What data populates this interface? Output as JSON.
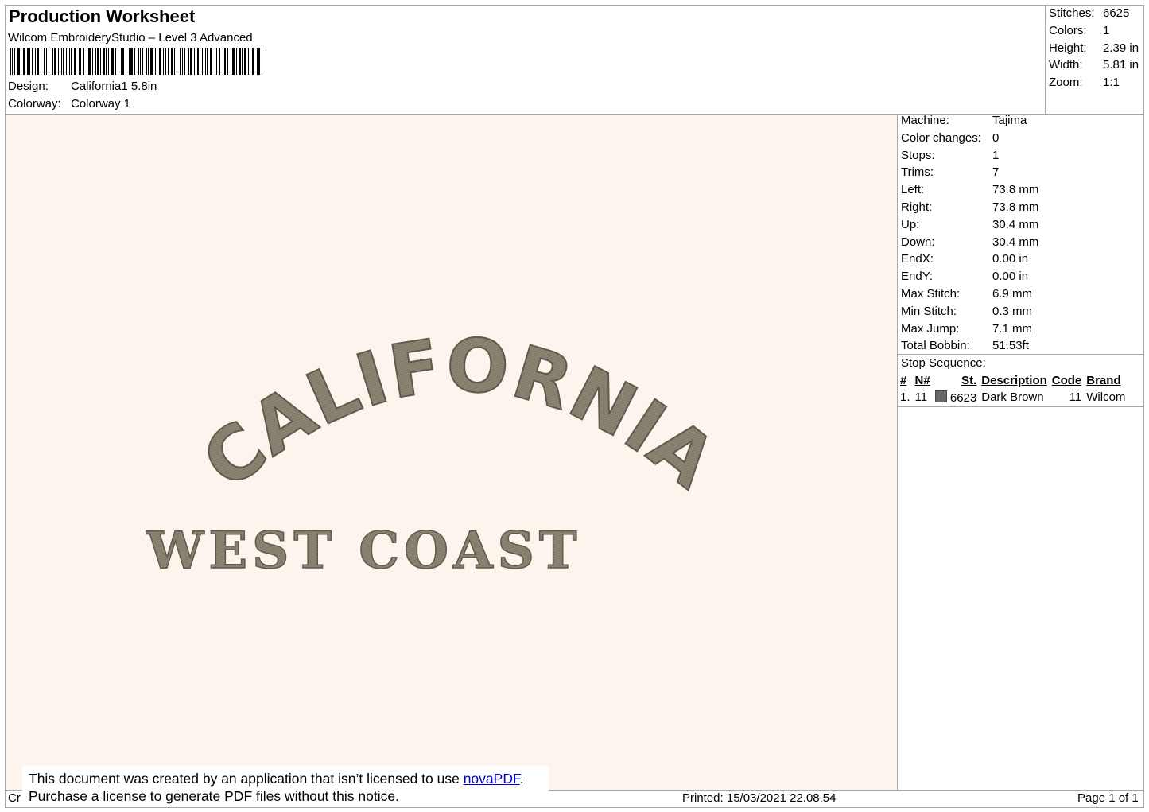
{
  "header": {
    "title": "Production Worksheet",
    "software": "Wilcom EmbroideryStudio – Level 3 Advanced",
    "design_label": "Design:",
    "design_value": "California1 5.8in",
    "colorway_label": "Colorway:",
    "colorway_value": "Colorway 1"
  },
  "summary": [
    {
      "label": "Stitches:",
      "value": "6625"
    },
    {
      "label": "Colors:",
      "value": "1"
    },
    {
      "label": "Height:",
      "value": "2.39 in"
    },
    {
      "label": "Width:",
      "value": "5.81 in"
    },
    {
      "label": "Zoom:",
      "value": "1:1"
    }
  ],
  "details": [
    {
      "label": "Machine:",
      "value": "Tajima"
    },
    {
      "label": "Color changes:",
      "value": "0"
    },
    {
      "label": "Stops:",
      "value": "1"
    },
    {
      "label": "Trims:",
      "value": "7"
    },
    {
      "label": "Left:",
      "value": "73.8 mm"
    },
    {
      "label": "Right:",
      "value": "73.8 mm"
    },
    {
      "label": "Up:",
      "value": "30.4 mm"
    },
    {
      "label": "Down:",
      "value": "30.4 mm"
    },
    {
      "label": "EndX:",
      "value": "0.00 in"
    },
    {
      "label": "EndY:",
      "value": "0.00 in"
    },
    {
      "label": "Max Stitch:",
      "value": "6.9 mm"
    },
    {
      "label": "Min Stitch:",
      "value": "0.3 mm"
    },
    {
      "label": "Max Jump:",
      "value": "7.1 mm"
    },
    {
      "label": "Total Bobbin:",
      "value": "51.53ft"
    }
  ],
  "stop_sequence": {
    "title": "Stop Sequence:",
    "columns": [
      "#",
      "N#",
      "St.",
      "Description",
      "Code",
      "Brand"
    ],
    "rows": [
      {
        "num": "1.",
        "n": "11",
        "color": "#6e6660",
        "st": "6623",
        "description": "Dark Brown",
        "code": "11",
        "brand": "Wilcom"
      }
    ]
  },
  "design": {
    "arc_text": "CALIFORNIA",
    "sub_text": "WEST COAST",
    "thread_color": "#8a8473",
    "background_color": "#fdf4ee"
  },
  "notice": {
    "line1_prefix": "This document was created by an application that isn’t licensed to use ",
    "link": "novaPDF",
    "line1_suffix": ".",
    "line2": "Purchase a license to generate PDF files without this notice."
  },
  "footer": {
    "left_truncated": "Cr",
    "printed": "Printed: 15/03/2021 22.08.54",
    "page": "Page 1 of 1"
  }
}
